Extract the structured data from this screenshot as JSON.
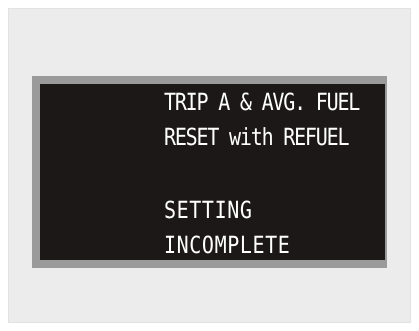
{
  "display": {
    "lines": [
      "TRIP A & AVG. FUEL",
      "RESET with REFUEL",
      "SETTING",
      "INCOMPLETE"
    ],
    "colors": {
      "outer_panel": "#ececec",
      "bezel": "#9a9a9a",
      "screen_background": "#1c1818",
      "text": "#ffffff"
    }
  }
}
